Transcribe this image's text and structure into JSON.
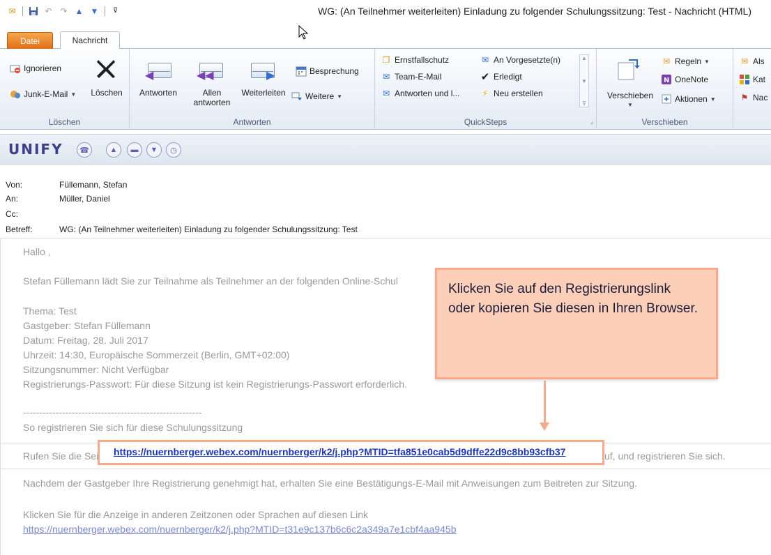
{
  "window": {
    "title": "WG: (An Teilnehmer weiterleiten) Einladung zu folgender Schulungssitzung: Test  -  Nachricht (HTML)"
  },
  "tabs": [
    {
      "label": "Datei"
    },
    {
      "label": "Nachricht"
    }
  ],
  "ribbon": {
    "loeschen": {
      "ignore": "Ignorieren",
      "junk": "Junk-E-Mail",
      "delete": "Löschen",
      "group": "Löschen"
    },
    "antworten": {
      "reply": "Antworten",
      "reply_all_1": "Allen",
      "reply_all_2": "antworten",
      "forward": "Weiterleiten",
      "meeting": "Besprechung",
      "more": "Weitere",
      "group": "Antworten"
    },
    "quicksteps": {
      "items": [
        "Ernstfallschutz",
        "An Vorgesetzte(n)",
        "Team-E-Mail",
        "Erledigt",
        "Antworten und l...",
        "Neu erstellen"
      ],
      "group": "QuickSteps"
    },
    "verschieben": {
      "move": "Verschieben",
      "rules": "Regeln",
      "onenote": "OneNote",
      "actions": "Aktionen",
      "group": "Verschieben"
    },
    "extra": {
      "item1": "Als",
      "item2": "Kat",
      "item3": "Nac"
    }
  },
  "unify": {
    "logo": "UNIFY"
  },
  "header": {
    "from_label": "Von:",
    "from_value": "Füllemann, Stefan",
    "to_label": "An:",
    "to_value": "Müller, Daniel",
    "cc_label": "Cc:",
    "cc_value": "",
    "subject_label": "Betreff:",
    "subject_value": "WG: (An Teilnehmer weiterleiten) Einladung zu folgender Schulungssitzung: Test"
  },
  "body": {
    "greeting": "Hallo ,",
    "intro": "Stefan Füllemann lädt Sie zur Teilnahme als Teilnehmer an der folgenden Online-Schul",
    "topic": "Thema: Test",
    "host": "Gastgeber: Stefan Füllemann",
    "date": "Datum: Freitag, 28. Juli 2017",
    "time": "Uhrzeit: 14:30, Europäische Sommerzeit (Berlin, GMT+02:00)",
    "session": "Sitzungsnummer: Nicht Verfügbar",
    "password": "Registrierungs-Passwort: Für diese Sitzung ist kein Registrierungs-Passwort erforderlich.",
    "divider": "-------------------------------------------------------",
    "register_heading": "So registrieren Sie sich für diese Schulungssitzung",
    "call_prefix": "Rufen Sie die Seite",
    "call_suffix": "uf, und registrieren Sie sich.",
    "register_link": "https://nuernberger.webex.com/nuernberger/k2/j.php?MTID=tfa851e0cab5d9dffe22d9c8bb93cfb37",
    "after_approval": "Nachdem der Gastgeber Ihre Registrierung genehmigt hat, erhalten Sie eine Bestätigungs-E-Mail mit Anweisungen zum Beitreten zur Sitzung.",
    "timezone_text": "Klicken Sie für die Anzeige in anderen Zeitzonen oder Sprachen auf diesen Link",
    "timezone_link": "https://nuernberger.webex.com/nuernberger/k2/j.php?MTID=t31e9c137b6c6c2a349a7e1cbf4aa945b"
  },
  "callout": {
    "text": "Klicken Sie auf den Registrierungslink oder kopieren Sie diesen in Ihren Browser."
  },
  "colors": {
    "callout_fill": "#fbcfb8",
    "callout_border": "#f7a98a",
    "link": "#1a35c8",
    "datei_tab": "#e06b15"
  }
}
